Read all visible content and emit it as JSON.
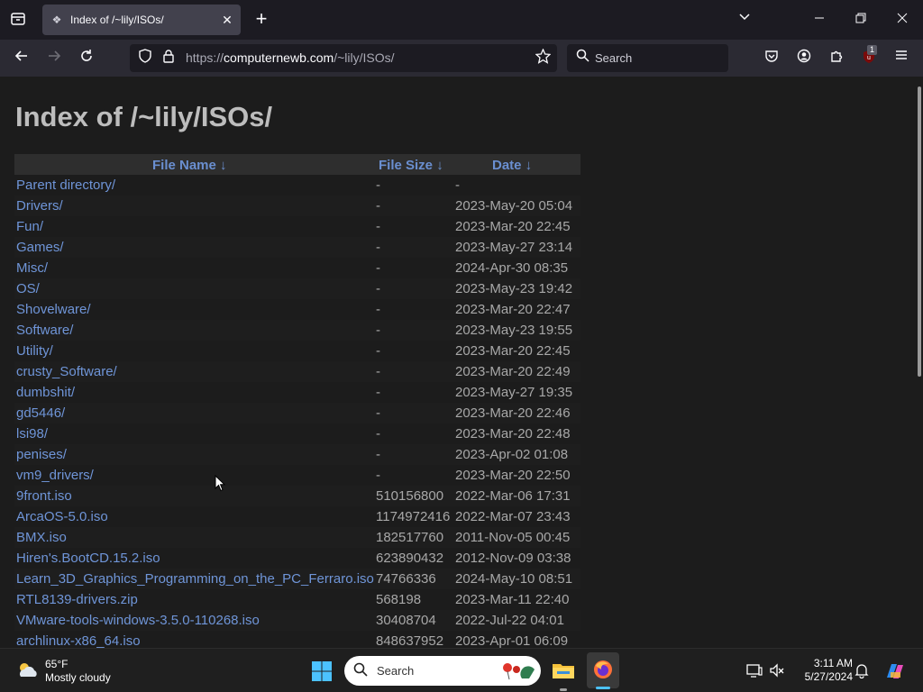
{
  "browser": {
    "tab_title": "Index of /~lily/ISOs/",
    "url_prefix": "https://",
    "url_host": "computernewb.com",
    "url_path": "/~lily/ISOs/",
    "search_placeholder": "Search",
    "extension_badge": "1"
  },
  "page": {
    "heading": "Index of /~lily/ISOs/",
    "columns": {
      "name": "File Name  ↓",
      "size": "File Size  ↓",
      "date": "Date  ↓"
    },
    "rows": [
      {
        "name": "Parent directory/",
        "size": "-",
        "date": "-"
      },
      {
        "name": "Drivers/",
        "size": "-",
        "date": "2023-May-20 05:04"
      },
      {
        "name": "Fun/",
        "size": "-",
        "date": "2023-Mar-20 22:45"
      },
      {
        "name": "Games/",
        "size": "-",
        "date": "2023-May-27 23:14"
      },
      {
        "name": "Misc/",
        "size": "-",
        "date": "2024-Apr-30 08:35"
      },
      {
        "name": "OS/",
        "size": "-",
        "date": "2023-May-23 19:42"
      },
      {
        "name": "Shovelware/",
        "size": "-",
        "date": "2023-Mar-20 22:47"
      },
      {
        "name": "Software/",
        "size": "-",
        "date": "2023-May-23 19:55"
      },
      {
        "name": "Utility/",
        "size": "-",
        "date": "2023-Mar-20 22:45"
      },
      {
        "name": "crusty_Software/",
        "size": "-",
        "date": "2023-Mar-20 22:49"
      },
      {
        "name": "dumbshit/",
        "size": "-",
        "date": "2023-May-27 19:35"
      },
      {
        "name": "gd5446/",
        "size": "-",
        "date": "2023-Mar-20 22:46"
      },
      {
        "name": "lsi98/",
        "size": "-",
        "date": "2023-Mar-20 22:48"
      },
      {
        "name": "penises/",
        "size": "-",
        "date": "2023-Apr-02 01:08"
      },
      {
        "name": "vm9_drivers/",
        "size": "-",
        "date": "2023-Mar-20 22:50"
      },
      {
        "name": "9front.iso",
        "size": "510156800",
        "date": "2022-Mar-06 17:31"
      },
      {
        "name": "ArcaOS-5.0.iso",
        "size": "1174972416",
        "date": "2022-Mar-07 23:43"
      },
      {
        "name": "BMX.iso",
        "size": "182517760",
        "date": "2011-Nov-05 00:45"
      },
      {
        "name": "Hiren's.BootCD.15.2.iso",
        "size": "623890432",
        "date": "2012-Nov-09 03:38"
      },
      {
        "name": "Learn_3D_Graphics_Programming_on_the_PC_Ferraro.iso",
        "size": "74766336",
        "date": "2024-May-10 08:51"
      },
      {
        "name": "RTL8139-drivers.zip",
        "size": "568198",
        "date": "2023-Mar-11 22:40"
      },
      {
        "name": "VMware-tools-windows-3.5.0-110268.iso",
        "size": "30408704",
        "date": "2022-Jul-22 04:01"
      },
      {
        "name": "archlinux-x86_64.iso",
        "size": "848637952",
        "date": "2023-Apr-01 06:09"
      }
    ]
  },
  "taskbar": {
    "temperature": "65°F",
    "condition": "Mostly cloudy",
    "search_placeholder": "Search",
    "time": "3:11 AM",
    "date": "5/27/2024"
  }
}
